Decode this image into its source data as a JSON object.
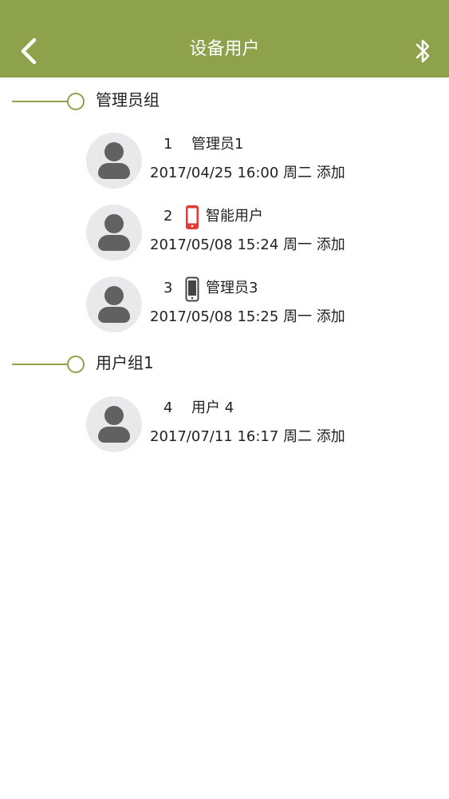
{
  "header": {
    "title": "设备用户",
    "back_icon": "chevron-left-icon",
    "bluetooth_icon": "bluetooth-icon",
    "color": "#8ea24b"
  },
  "groups": [
    {
      "name": "管理员组",
      "users": [
        {
          "number": "1",
          "name": "管理员1",
          "device_icon": null,
          "datetime": "2017/04/25 16:00",
          "weekday": "周二",
          "action": "添加"
        },
        {
          "number": "2",
          "name": "智能用户",
          "device_icon": "red-phone-icon",
          "device_color": "#e53935",
          "datetime": "2017/05/08 15:24",
          "weekday": "周一",
          "action": "添加"
        },
        {
          "number": "3",
          "name": "管理员3",
          "device_icon": "phone-icon",
          "device_color": "#444444",
          "datetime": "2017/05/08 15:25",
          "weekday": "周一",
          "action": "添加"
        }
      ]
    },
    {
      "name": "用户组1",
      "users": [
        {
          "number": "4",
          "name": "用户 4",
          "device_icon": null,
          "datetime": "2017/07/11 16:17",
          "weekday": "周二",
          "action": "添加"
        }
      ]
    }
  ]
}
